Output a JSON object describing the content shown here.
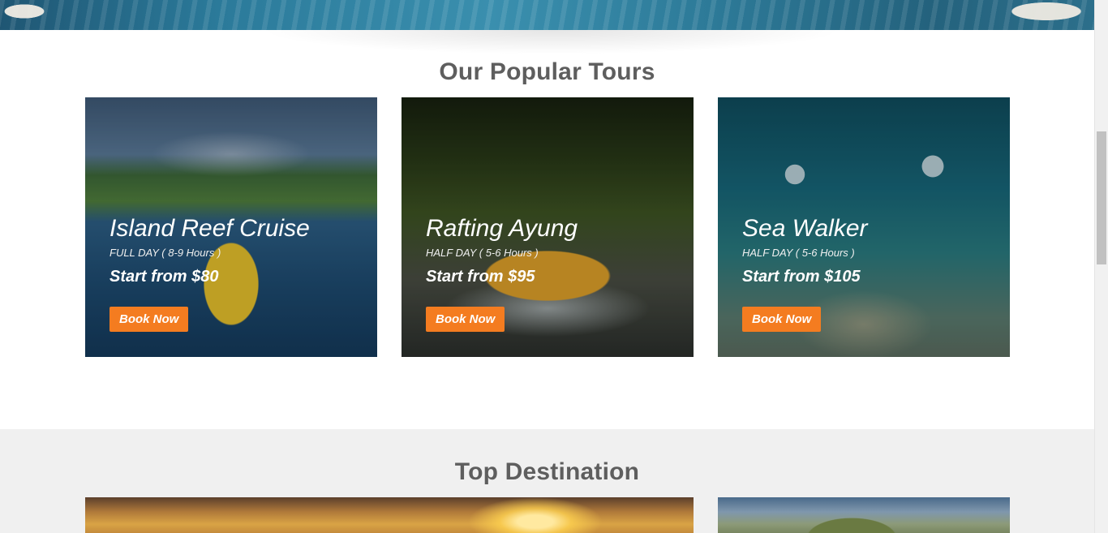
{
  "popular_tours": {
    "title": "Our Popular Tours",
    "cards": [
      {
        "name": "Island Reef Cruise",
        "duration": "FULL DAY ( 8-9 Hours )",
        "price": "Start from $80",
        "button": "Book Now"
      },
      {
        "name": "Rafting Ayung",
        "duration": "HALF DAY ( 5-6 Hours )",
        "price": "Start from $95",
        "button": "Book Now"
      },
      {
        "name": "Sea Walker",
        "duration": "HALF DAY ( 5-6 Hours )",
        "price": "Start from $105",
        "button": "Book Now"
      }
    ]
  },
  "top_destination": {
    "title": "Top Destination"
  },
  "colors": {
    "accent": "#f47c20",
    "heading": "#5e5e5e",
    "section_bg": "#f0f0f0"
  }
}
